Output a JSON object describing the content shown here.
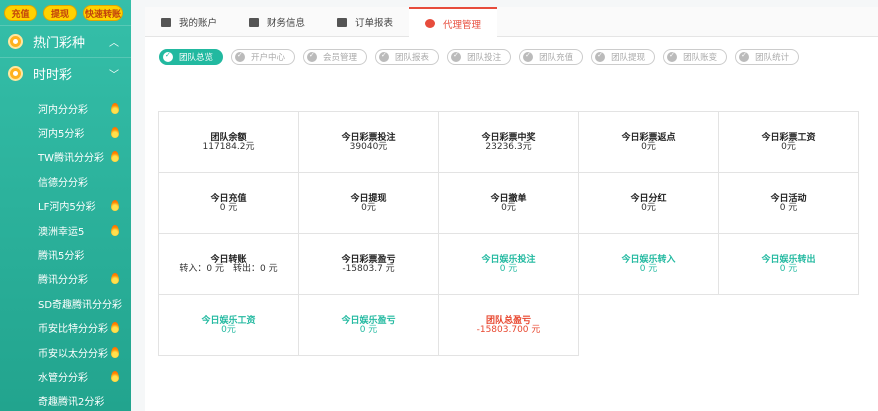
{
  "sidebar": {
    "top_buttons": [
      "充值",
      "提现",
      "快速转账"
    ],
    "categories": [
      {
        "label": "热门彩种",
        "chevron": "︿"
      },
      {
        "label": "时时彩",
        "chevron": "﹀"
      }
    ],
    "items": [
      {
        "label": "河内分分彩",
        "hot": true
      },
      {
        "label": "河内5分彩",
        "hot": true
      },
      {
        "label": "TW腾讯分分彩",
        "hot": true
      },
      {
        "label": "信德分分彩",
        "hot": false
      },
      {
        "label": "LF河内5分彩",
        "hot": true
      },
      {
        "label": "澳洲幸运5",
        "hot": true
      },
      {
        "label": "腾讯5分彩",
        "hot": false
      },
      {
        "label": "腾讯分分彩",
        "hot": true
      },
      {
        "label": "SD奇趣腾讯分分彩",
        "hot": false
      },
      {
        "label": "币安比特分分彩",
        "hot": true
      },
      {
        "label": "币安以太分分彩",
        "hot": true
      },
      {
        "label": "水管分分彩",
        "hot": true
      },
      {
        "label": "奇趣腾讯2分彩",
        "hot": false
      }
    ]
  },
  "tabs": [
    {
      "label": "我的账户",
      "icon": "account-icon"
    },
    {
      "label": "财务信息",
      "icon": "finance-icon"
    },
    {
      "label": "订单报表",
      "icon": "report-icon"
    },
    {
      "label": "代理管理",
      "icon": "agent-icon",
      "active": true
    }
  ],
  "subtabs": [
    "团队总览",
    "开户中心",
    "会员管理",
    "团队报表",
    "团队投注",
    "团队充值",
    "团队提现",
    "团队账变",
    "团队统计"
  ],
  "stats": [
    {
      "label": "团队余额",
      "value": "117184.2元"
    },
    {
      "label": "今日彩票投注",
      "value": "39040元"
    },
    {
      "label": "今日彩票中奖",
      "value": "23236.3元"
    },
    {
      "label": "今日彩票返点",
      "value": "0元"
    },
    {
      "label": "今日彩票工资",
      "value": "0元"
    },
    {
      "label": "今日充值",
      "value": "0 元"
    },
    {
      "label": "今日提现",
      "value": "0元"
    },
    {
      "label": "今日撤单",
      "value": "0元"
    },
    {
      "label": "今日分红",
      "value": "0元"
    },
    {
      "label": "今日活动",
      "value": "0 元"
    },
    {
      "label": "今日转账",
      "value": "转入：0 元　转出：0 元"
    },
    {
      "label": "今日彩票盈亏",
      "value": "-15803.7 元"
    },
    {
      "label": "今日娱乐投注",
      "value": "0 元",
      "color": "teal"
    },
    {
      "label": "今日娱乐转入",
      "value": "0 元",
      "color": "teal"
    },
    {
      "label": "今日娱乐转出",
      "value": "0 元",
      "color": "teal"
    },
    {
      "label": "今日娱乐工资",
      "value": "0元",
      "color": "teal"
    },
    {
      "label": "今日娱乐盈亏",
      "value": "0 元",
      "color": "teal"
    },
    {
      "label": "团队总盈亏",
      "value": "-15803.700 元",
      "color": "red"
    }
  ],
  "colors": {
    "sidebar": "#2bb39c",
    "accent": "#22b9a0",
    "active_tab": "#e74c3c",
    "loss": "#e8462e"
  }
}
